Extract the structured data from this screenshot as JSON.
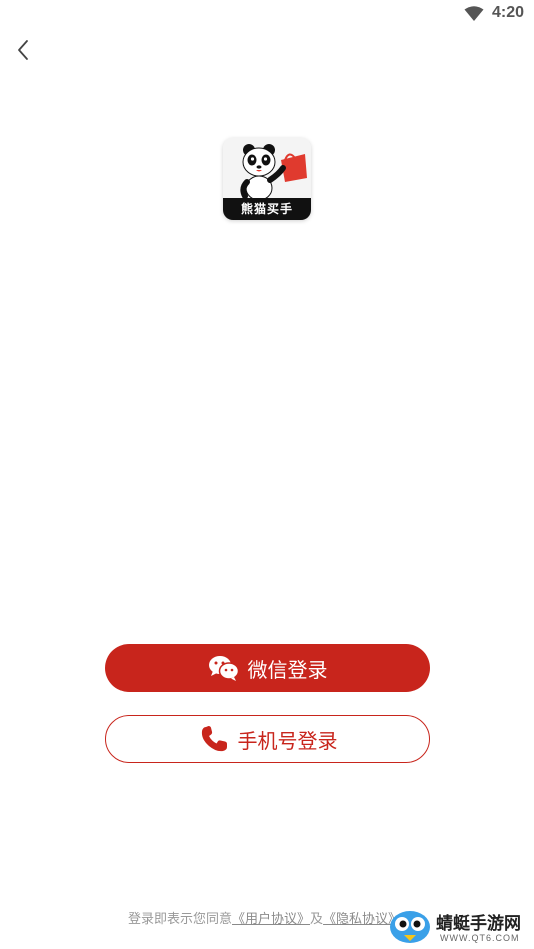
{
  "status_bar": {
    "time": "4:20",
    "wifi_icon": "wifi-icon"
  },
  "header": {
    "back_icon": "chevron-left-icon"
  },
  "app": {
    "logo_text": "熊猫买手",
    "logo_icon": "panda-logo-icon"
  },
  "login": {
    "wechat_label": "微信登录",
    "wechat_icon": "wechat-icon",
    "phone_label": "手机号登录",
    "phone_icon": "phone-icon"
  },
  "agreement": {
    "prefix": "登录即表示您同意",
    "user_agreement": "《用户协议》",
    "conjunction": "及",
    "privacy_policy": "《隐私协议》"
  },
  "watermark": {
    "title": "蜻蜓手游网",
    "url": "WWW.QT6.COM"
  },
  "colors": {
    "accent": "#c8251c",
    "muted_text": "#999999"
  }
}
